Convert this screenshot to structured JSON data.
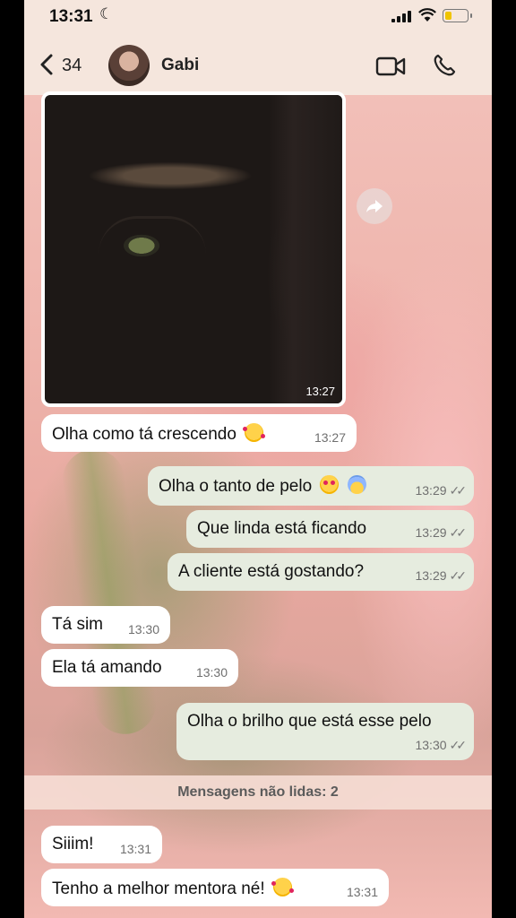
{
  "status_bar": {
    "time": "13:31",
    "moon": "☾"
  },
  "header": {
    "back_count": "34",
    "contact_name": "Gabi"
  },
  "image_message": {
    "time": "13:27"
  },
  "messages": [
    {
      "dir": "in",
      "text": "Olha como tá crescendo",
      "emoji": "smiling-face-with-hearts",
      "time": "13:27"
    },
    {
      "dir": "out",
      "text": "Olha o tanto de pelo",
      "emoji": "heart-eyes+scream",
      "time": "13:29",
      "ticks": "✓✓"
    },
    {
      "dir": "out",
      "text": "Que linda está ficando",
      "time": "13:29",
      "ticks": "✓✓"
    },
    {
      "dir": "out",
      "text": "A cliente está gostando?",
      "time": "13:29",
      "ticks": "✓✓"
    },
    {
      "dir": "in",
      "text": "Tá sim",
      "time": "13:30"
    },
    {
      "dir": "in",
      "text": "Ela tá amando",
      "time": "13:30"
    },
    {
      "dir": "out",
      "text": "Olha o brilho que está esse pelo",
      "time": "13:30",
      "ticks": "✓✓"
    },
    {
      "dir": "in",
      "text": "Siiim!",
      "time": "13:31"
    },
    {
      "dir": "in",
      "text": "Tenho a melhor mentora né!",
      "emoji": "smiling-face-with-hearts",
      "time": "13:31"
    }
  ],
  "unread_divider": "Mensagens não lidas: 2",
  "colors": {
    "incoming_bubble": "#ffffff",
    "outgoing_bubble": "#e6ecdf",
    "header_bg": "#f5e6dd"
  }
}
